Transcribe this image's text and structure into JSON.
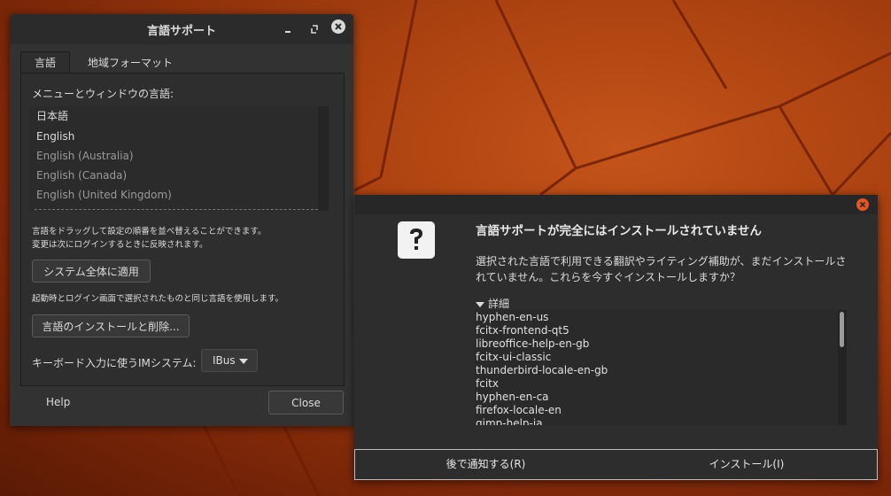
{
  "window": {
    "title": "言語サポート",
    "tabs": [
      {
        "label": "言語",
        "active": true
      },
      {
        "label": "地域フォーマット",
        "active": false
      }
    ],
    "menu_language_label": "メニューとウィンドウの言語:",
    "languages": [
      {
        "label": "日本語",
        "color": "#dcdcdc"
      },
      {
        "label": "English",
        "color": "#dcdcdc"
      },
      {
        "label": "English (Australia)",
        "color": "#9a9a9a"
      },
      {
        "label": "English (Canada)",
        "color": "#9a9a9a"
      },
      {
        "label": "English (United Kingdom)",
        "color": "#9a9a9a"
      }
    ],
    "drag_hint": "言語をドラッグして設定の順番を並べ替えることができます。",
    "drag_hint_sub": "変更は次にログインするときに反映されます。",
    "apply_system_wide_label": "システム全体に適用",
    "apply_hint": "起動時とログイン画面で選択されたものと同じ言語を使用します。",
    "install_remove_label": "言語のインストールと削除...",
    "im_system_label": "キーボード入力に使うIMシステム:",
    "im_system_value": "IBus",
    "help_label": "Help",
    "close_label": "Close"
  },
  "dialog": {
    "heading": "言語サポートが完全にはインストールされていません",
    "message": "選択された言語で利用できる翻訳やライティング補助が、まだインストールされていません。これらを今すぐインストールしますか？",
    "details_label": "詳細",
    "packages": [
      "hyphen-en-us",
      "fcitx-frontend-qt5",
      "libreoffice-help-en-gb",
      "fcitx-ui-classic",
      "thunderbird-locale-en-gb",
      "fcitx",
      "hyphen-en-ca",
      "firefox-locale-en",
      "gimp-help-ja"
    ],
    "remind_later_label": "後で通知する(R)",
    "install_label": "インストール(I)"
  },
  "colors": {
    "accent_close": "#e95420"
  }
}
